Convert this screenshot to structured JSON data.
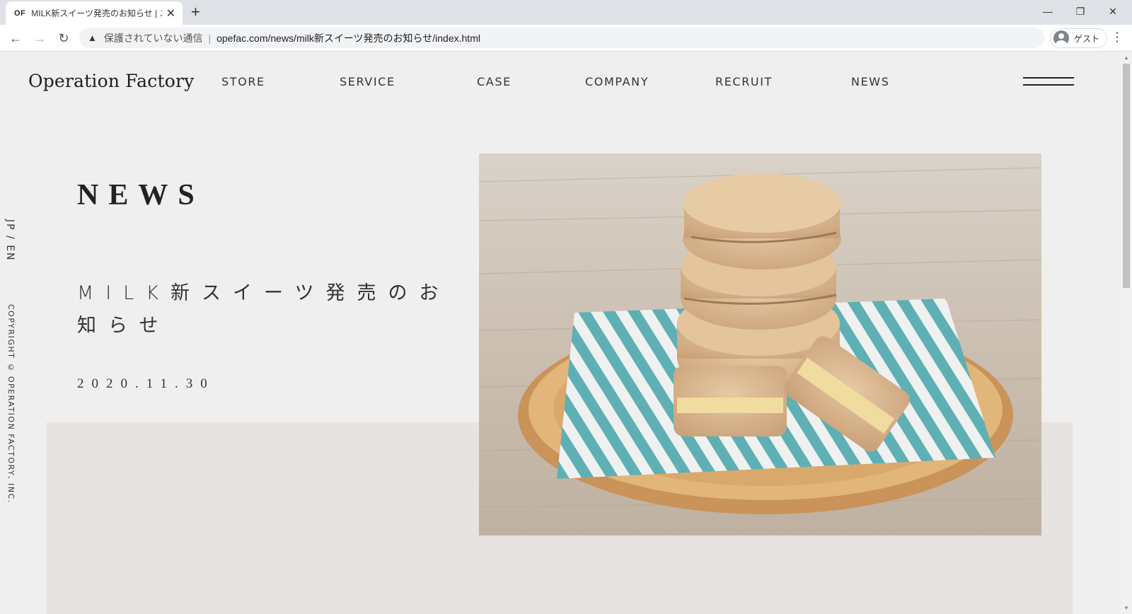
{
  "browser": {
    "tab": {
      "favicon_text": "OF",
      "title": "MILK新スイーツ発売のお知らせ | ニコ"
    },
    "omnibox": {
      "security_label": "保護されていない通信",
      "separator": "|",
      "url": "opefac.com/news/milk新スイーツ発売のお知らせ/index.html"
    },
    "profile_label": "ゲスト"
  },
  "site": {
    "logo": "Operation Factory",
    "nav": [
      "STORE",
      "SERVICE",
      "CASE",
      "COMPANY",
      "RECRUIT",
      "NEWS"
    ],
    "language_switch": "JP / EN",
    "copyright": "COPYRIGHT © OPERATION FACTORY, INC."
  },
  "article": {
    "section_title": "NEWS",
    "title": "MILK新スイーツ発売のお知らせ",
    "date": "2020.11.30",
    "image_alt": "stacked cookie sandwiches on striped paper and wooden plate"
  },
  "colors": {
    "page_bg": "#efefef",
    "panel_bg": "#e6e3e1",
    "text": "#333333",
    "stripe_teal": "#5fb0b4"
  }
}
